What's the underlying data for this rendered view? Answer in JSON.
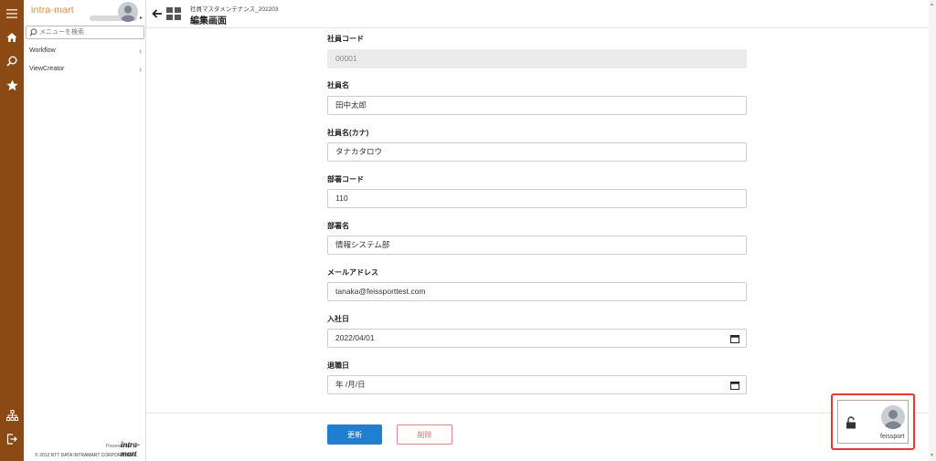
{
  "app": {
    "brand": "intra-mart"
  },
  "sidebar": {
    "search_placeholder": "メニューを検索",
    "items": [
      {
        "label": "Workflow"
      },
      {
        "label": "ViewCreator"
      }
    ],
    "powered_by": "Powered by",
    "powered_logo": "intra-mart",
    "copyright": "© 2012 NTT DATA INTRAMART CORPORATION"
  },
  "header": {
    "subtitle": "社員マスタメンテナンス_202203",
    "title": "編集画面"
  },
  "form": {
    "fields": [
      {
        "label": "社員コード",
        "value": "00001",
        "readonly": true
      },
      {
        "label": "社員名",
        "value": "田中太郎"
      },
      {
        "label": "社員名(カナ)",
        "value": "タナカタロウ"
      },
      {
        "label": "部署コード",
        "value": "110"
      },
      {
        "label": "部署名",
        "value": "情報システム部"
      },
      {
        "label": "メールアドレス",
        "value": "tanaka@feissporttest.com"
      },
      {
        "label": "入社日",
        "value": "2022/04/01"
      },
      {
        "label": "退職日",
        "value": "年 /月/日"
      }
    ],
    "update_label": "更新",
    "delete_label": "削除"
  },
  "floating_user": {
    "name": "feissport"
  },
  "colors": {
    "rail": "#8b4a14",
    "brand": "#e08a3c",
    "primary": "#1f7fd0",
    "danger": "#e06b6b",
    "highlight": "#e03a3a"
  },
  "icons": [
    "hamburger-icon",
    "home-icon",
    "search-icon",
    "star-icon",
    "sitemap-icon",
    "logout-icon",
    "back-arrow-icon",
    "grid-icon",
    "calendar-icon",
    "lock-icon"
  ]
}
